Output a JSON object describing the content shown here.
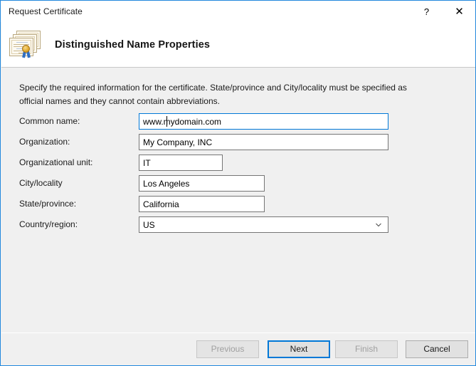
{
  "window": {
    "title": "Request Certificate",
    "help_glyph": "?",
    "close_glyph": "✕",
    "accent_color": "#0078d7",
    "border_color": "#2288dd",
    "body_color": "#f0f0f0"
  },
  "header": {
    "heading": "Distinguished Name Properties",
    "icon": "certificate-stack-icon"
  },
  "main": {
    "instructions": "Specify the required information for the certificate. State/province and City/locality must be specified as official names and they cannot contain abbreviations.",
    "fields": [
      {
        "name": "common-name",
        "label": "Common name:",
        "value": "www.mydomain.com",
        "placeholder": "",
        "type": "text",
        "width": "wide",
        "focused": true,
        "caret_after": "www."
      },
      {
        "name": "organization",
        "label": "Organization:",
        "value": "My Company, INC",
        "placeholder": "",
        "type": "text",
        "width": "wide",
        "focused": false
      },
      {
        "name": "organizational-unit",
        "label": "Organizational unit:",
        "value": "IT",
        "placeholder": "",
        "type": "text",
        "width": "narrow",
        "focused": false
      },
      {
        "name": "city-locality",
        "label": "City/locality",
        "value": "Los Angeles",
        "placeholder": "",
        "type": "text",
        "width": "mid",
        "focused": false
      },
      {
        "name": "state-province",
        "label": "State/province:",
        "value": "California",
        "placeholder": "",
        "type": "text",
        "width": "mid",
        "focused": false
      },
      {
        "name": "country-region",
        "label": "Country/region:",
        "value": "US",
        "placeholder": "",
        "type": "select",
        "width": "wide",
        "focused": false,
        "options": [
          "US"
        ]
      }
    ]
  },
  "footer": {
    "buttons": [
      {
        "name": "previous",
        "label": "Previous",
        "state": "disabled"
      },
      {
        "name": "next",
        "label": "Next",
        "state": "default"
      },
      {
        "name": "finish",
        "label": "Finish",
        "state": "disabled"
      },
      {
        "name": "cancel",
        "label": "Cancel",
        "state": "normal"
      }
    ]
  }
}
